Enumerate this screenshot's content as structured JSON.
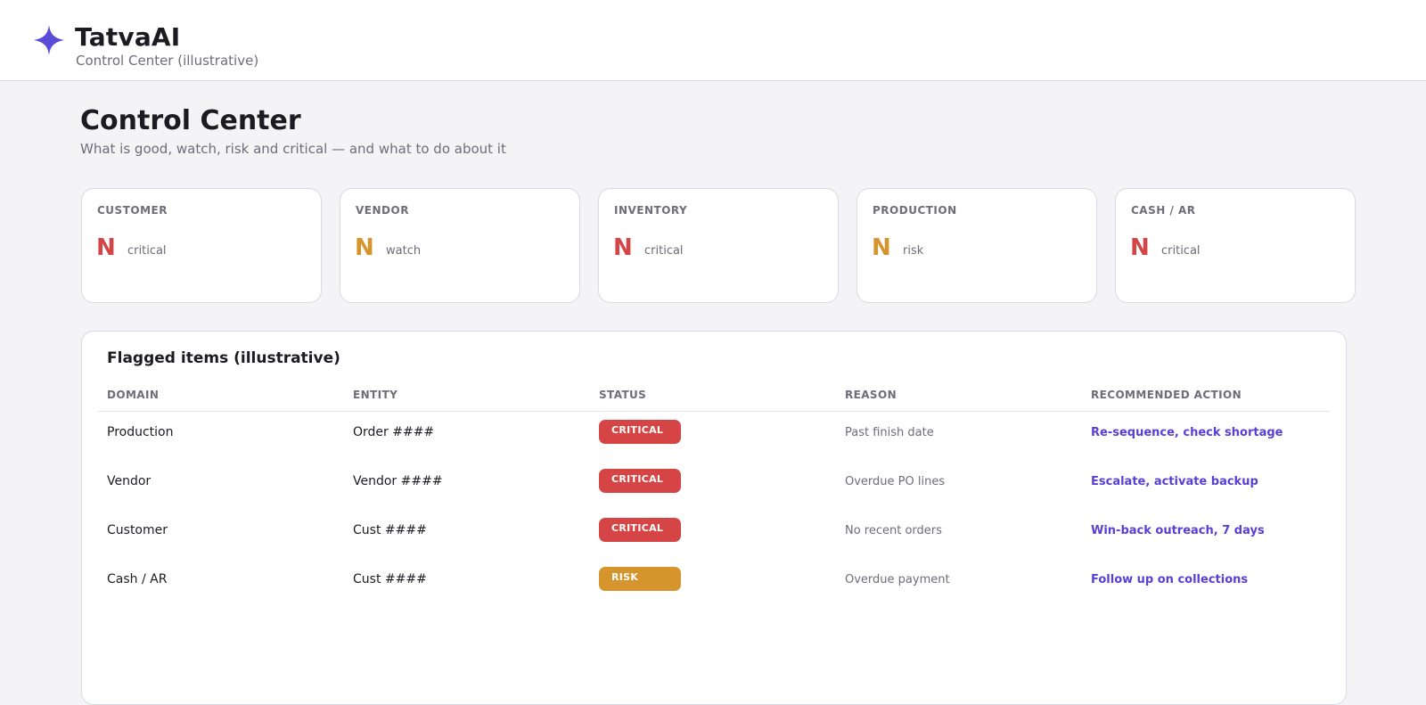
{
  "app": {
    "name": "TatvaAI",
    "subtitle": "Control Center (illustrative)",
    "logo_icon": "sparkle-star-icon",
    "accent_color": "#5b4bd9"
  },
  "page": {
    "title": "Control Center",
    "subtitle": "What is good, watch, risk and critical — and what to do about it"
  },
  "status_colors": {
    "critical": "#d64545",
    "watch": "#d6952c",
    "risk": "#d6952c"
  },
  "cards": [
    {
      "label": "CUSTOMER",
      "value": "N",
      "state": "critical",
      "color": "#d64545"
    },
    {
      "label": "VENDOR",
      "value": "N",
      "state": "watch",
      "color": "#d6952c"
    },
    {
      "label": "INVENTORY",
      "value": "N",
      "state": "critical",
      "color": "#d64545"
    },
    {
      "label": "PRODUCTION",
      "value": "N",
      "state": "risk",
      "color": "#d6952c"
    },
    {
      "label": "CASH / AR",
      "value": "N",
      "state": "critical",
      "color": "#d64545"
    }
  ],
  "flagged": {
    "title": "Flagged items (illustrative)",
    "columns": [
      "DOMAIN",
      "ENTITY",
      "STATUS",
      "REASON",
      "RECOMMENDED ACTION"
    ],
    "rows": [
      {
        "domain": "Production",
        "entity": "Order ####",
        "status": "CRITICAL",
        "status_color": "#d64545",
        "reason": "Past finish date",
        "action": "Re-sequence, check shortage"
      },
      {
        "domain": "Vendor",
        "entity": "Vendor ####",
        "status": "CRITICAL",
        "status_color": "#d64545",
        "reason": "Overdue PO lines",
        "action": "Escalate, activate backup"
      },
      {
        "domain": "Customer",
        "entity": "Cust ####",
        "status": "CRITICAL",
        "status_color": "#d64545",
        "reason": "No recent orders",
        "action": "Win-back outreach, 7 days"
      },
      {
        "domain": "Cash / AR",
        "entity": "Cust ####",
        "status": "RISK",
        "status_color": "#d6952c",
        "reason": "Overdue payment",
        "action": "Follow up on collections"
      }
    ]
  }
}
